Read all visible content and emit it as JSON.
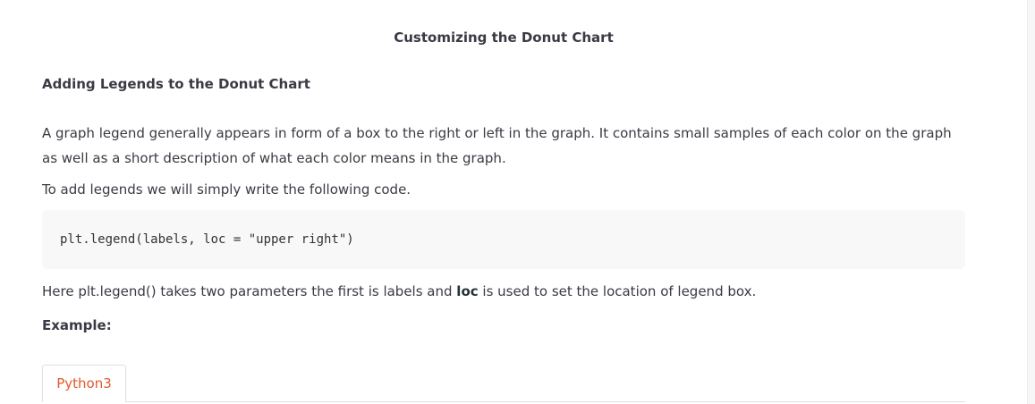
{
  "article": {
    "title": "Customizing the Donut Chart",
    "section_heading": "Adding Legends to the Donut Chart",
    "paragraph_1": "A graph legend generally appears in form of a box to the right or left in the graph. It contains small samples of each color on the graph as well as a short description of what each color means in the graph.",
    "paragraph_2": "To add legends we will simply write the following code.",
    "code": "plt.legend(labels, loc = \"upper right\")",
    "paragraph_3": {
      "before": "Here plt.legend() takes two parameters the first is labels and ",
      "bold": "loc",
      "after": " is used to set the location of legend box."
    },
    "example_label": "Example:"
  },
  "tabs": [
    {
      "label": "Python3"
    }
  ],
  "colors": {
    "text": "#3a3a44",
    "tab_accent": "#e2592b",
    "code_background": "#f8f8f8"
  }
}
